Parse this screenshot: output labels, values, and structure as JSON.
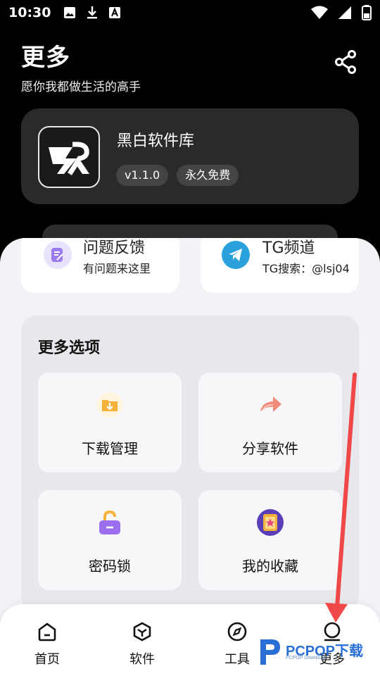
{
  "status_bar": {
    "time": "10:30",
    "left_icons": [
      "image-icon",
      "download-icon",
      "font-icon"
    ],
    "right_icons": [
      "wifi-icon",
      "signal-icon",
      "battery-icon"
    ]
  },
  "header": {
    "title": "更多",
    "subtitle": "愿你我都做生活的高手",
    "share_icon": "share-icon"
  },
  "app_card": {
    "name": "黑白软件库",
    "version": "v1.1.0",
    "tag": "永久免费"
  },
  "quick_links": [
    {
      "title": "问题反馈",
      "subtitle": "有问题来这里",
      "icon": "feedback-icon"
    },
    {
      "title": "TG频道",
      "subtitle": "TG搜索：@lsj04",
      "icon": "telegram-icon"
    }
  ],
  "options": {
    "title": "更多选项",
    "items": [
      {
        "label": "下载管理",
        "icon": "download-folder-icon"
      },
      {
        "label": "分享软件",
        "icon": "share-arrow-icon"
      },
      {
        "label": "密码锁",
        "icon": "lock-icon"
      },
      {
        "label": "我的收藏",
        "icon": "favorites-icon"
      }
    ]
  },
  "bottom_nav": [
    {
      "label": "首页",
      "icon": "home-icon",
      "active": false
    },
    {
      "label": "软件",
      "icon": "cube-icon",
      "active": false
    },
    {
      "label": "工具",
      "icon": "compass-icon",
      "active": false
    },
    {
      "label": "更多",
      "icon": "user-icon",
      "active": true
    }
  ],
  "watermark": {
    "text": "PCPOP下载",
    "sub": "PCPOP Download"
  },
  "colors": {
    "background": "#000000",
    "card": "#2a2a2a",
    "sheet": "#f2f2f7",
    "annotation_arrow": "#f04848",
    "telegram": "#2aa1da",
    "feedback": "#9b7cf0"
  }
}
